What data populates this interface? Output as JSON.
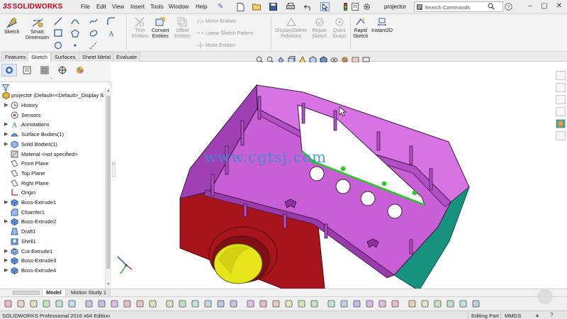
{
  "app": {
    "logo_prefix": "3S",
    "logo_text": "SOLIDWORKS",
    "document_name": "projector"
  },
  "menu": [
    "File",
    "Edit",
    "View",
    "Insert",
    "Tools",
    "Window",
    "Help"
  ],
  "search": {
    "placeholder": "Search Commands"
  },
  "ribbon": {
    "sketch": "Sketch",
    "smart_dimension": "Smart\nDimension",
    "trim": "Trim\nEntities",
    "convert": "Convert\nEntities",
    "offset": "Offset\nEntities",
    "mirror": "Mirror Entities",
    "linear_pattern": "Linear Sketch Pattern",
    "move": "Move Entities",
    "display_delete": "Display/Delete\nRelations",
    "repair": "Repair\nSketch",
    "quick_snaps": "Quick\nSnaps",
    "rapid_sketch": "Rapid\nSketch",
    "instant2d": "Instant2D"
  },
  "command_tabs": [
    {
      "label": "Features",
      "active": false
    },
    {
      "label": "Sketch",
      "active": true
    },
    {
      "label": "Surfaces",
      "active": false
    },
    {
      "label": "Sheet Metal",
      "active": false
    },
    {
      "label": "Evaluate",
      "active": false
    }
  ],
  "tree": {
    "root": "projector  (Default<<Default>_Display S",
    "items": [
      {
        "label": "History",
        "icon": "history-icon",
        "expand": true
      },
      {
        "label": "Sensors",
        "icon": "sensors-icon",
        "expand": false
      },
      {
        "label": "Annotations",
        "icon": "annotations-icon",
        "expand": true
      },
      {
        "label": "Surface Bodies(1)",
        "icon": "surface-bodies-icon",
        "expand": true
      },
      {
        "label": "Solid Bodies(1)",
        "icon": "solid-bodies-icon",
        "expand": true
      },
      {
        "label": "Material <not specified>",
        "icon": "material-icon",
        "expand": false
      },
      {
        "label": "Front Plane",
        "icon": "plane-icon",
        "expand": false
      },
      {
        "label": "Top Plane",
        "icon": "plane-icon",
        "expand": false
      },
      {
        "label": "Right Plane",
        "icon": "plane-icon",
        "expand": false
      },
      {
        "label": "Origin",
        "icon": "origin-icon",
        "expand": false
      },
      {
        "label": "Boss-Extrude1",
        "icon": "boss-extrude-icon",
        "expand": true
      },
      {
        "label": "Chamfer1",
        "icon": "chamfer-icon",
        "expand": false
      },
      {
        "label": "Boss-Extrude2",
        "icon": "boss-extrude-icon",
        "expand": true
      },
      {
        "label": "Draft1",
        "icon": "draft-icon",
        "expand": false
      },
      {
        "label": "Shell1",
        "icon": "shell-icon",
        "expand": false
      },
      {
        "label": "Cut-Extrude1",
        "icon": "cut-extrude-icon",
        "expand": true
      },
      {
        "label": "Boss-Extrude3",
        "icon": "boss-extrude-icon",
        "expand": true
      },
      {
        "label": "Boss-Extrude4",
        "icon": "boss-extrude-icon",
        "expand": true
      }
    ]
  },
  "watermark": "www.cgtsj.com",
  "model_tabs": [
    {
      "label": "Model",
      "active": true
    },
    {
      "label": "Motion Study 1",
      "active": false
    }
  ],
  "status": {
    "app": "SOLIDWORKS Professional 2016 x64 Edition",
    "mode": "Editing Part",
    "units": "MMGS"
  },
  "colors": {
    "brand": "#d0021b",
    "part_purple": "#c85fd6",
    "part_red": "#a8141b",
    "part_teal": "#17927f",
    "lens_yellow": "#e5e51a",
    "selected_edge": "#22cc22"
  }
}
